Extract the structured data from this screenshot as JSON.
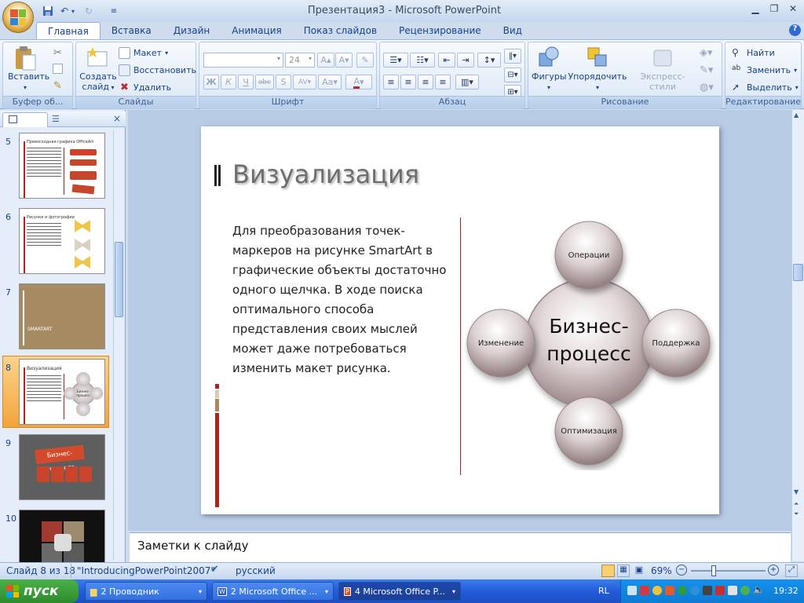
{
  "window": {
    "title": "Презентация3 - Microsoft PowerPoint"
  },
  "tabs": [
    "Главная",
    "Вставка",
    "Дизайн",
    "Анимация",
    "Показ слайдов",
    "Рецензирование",
    "Вид"
  ],
  "ribbon": {
    "clipboard": {
      "label": "Буфер об...",
      "paste": "Вставить"
    },
    "slides": {
      "label": "Слайды",
      "create_1": "Создать",
      "create_2": "слайд",
      "layout": "Макет",
      "reset": "Восстановить",
      "delete": "Удалить"
    },
    "font": {
      "label": "Шрифт",
      "size": "24"
    },
    "paragraph": {
      "label": "Абзац"
    },
    "drawing": {
      "label": "Рисование",
      "shapes": "Фигуры",
      "arrange": "Упорядочить",
      "quick_styles": "Экспресс-стили"
    },
    "editing": {
      "label": "Редактирование",
      "find": "Найти",
      "replace": "Заменить",
      "select": "Выделить"
    }
  },
  "thumbnails": [
    {
      "num": "5",
      "title": "Превосходная графика OfficeArt"
    },
    {
      "num": "6",
      "title": "Рисунки и фотографии"
    },
    {
      "num": "7",
      "title": "SMARTART"
    },
    {
      "num": "8",
      "title": "Визуализация",
      "subtitle": "Бизнес-процесс"
    },
    {
      "num": "9",
      "title": "Бизнес-процесс"
    },
    {
      "num": "10",
      "title": ""
    }
  ],
  "slide": {
    "title": "Визуализация",
    "body": [
      "Для преобразования точек-",
      "маркеров на рисунке SmartArt в",
      "графические объекты достаточно",
      "одного щелчка. В ходе поиска",
      "оптимального способа",
      "представления своих мыслей",
      "может даже потребоваться",
      "изменить макет рисунка."
    ],
    "diagram": {
      "center_1": "Бизнес-",
      "center_2": "процесс",
      "top": "Операции",
      "right": "Поддержка",
      "bottom": "Оптимизация",
      "left": "Изменение"
    }
  },
  "notes": {
    "placeholder": "Заметки к слайду"
  },
  "status": {
    "slide_of": "Слайд 8 из 18",
    "theme": "\"IntroducingPowerPoint2007\"",
    "language": "русский",
    "zoom": "69%"
  },
  "taskbar": {
    "start": "пуск",
    "tasks": [
      "2 Проводник",
      "2 Microsoft Office ...",
      "4 Microsoft Office P..."
    ],
    "lang": "RL",
    "time": "19:32"
  },
  "colors": {
    "accent_red": "#a32920",
    "ribbon_text": "#15428b"
  }
}
